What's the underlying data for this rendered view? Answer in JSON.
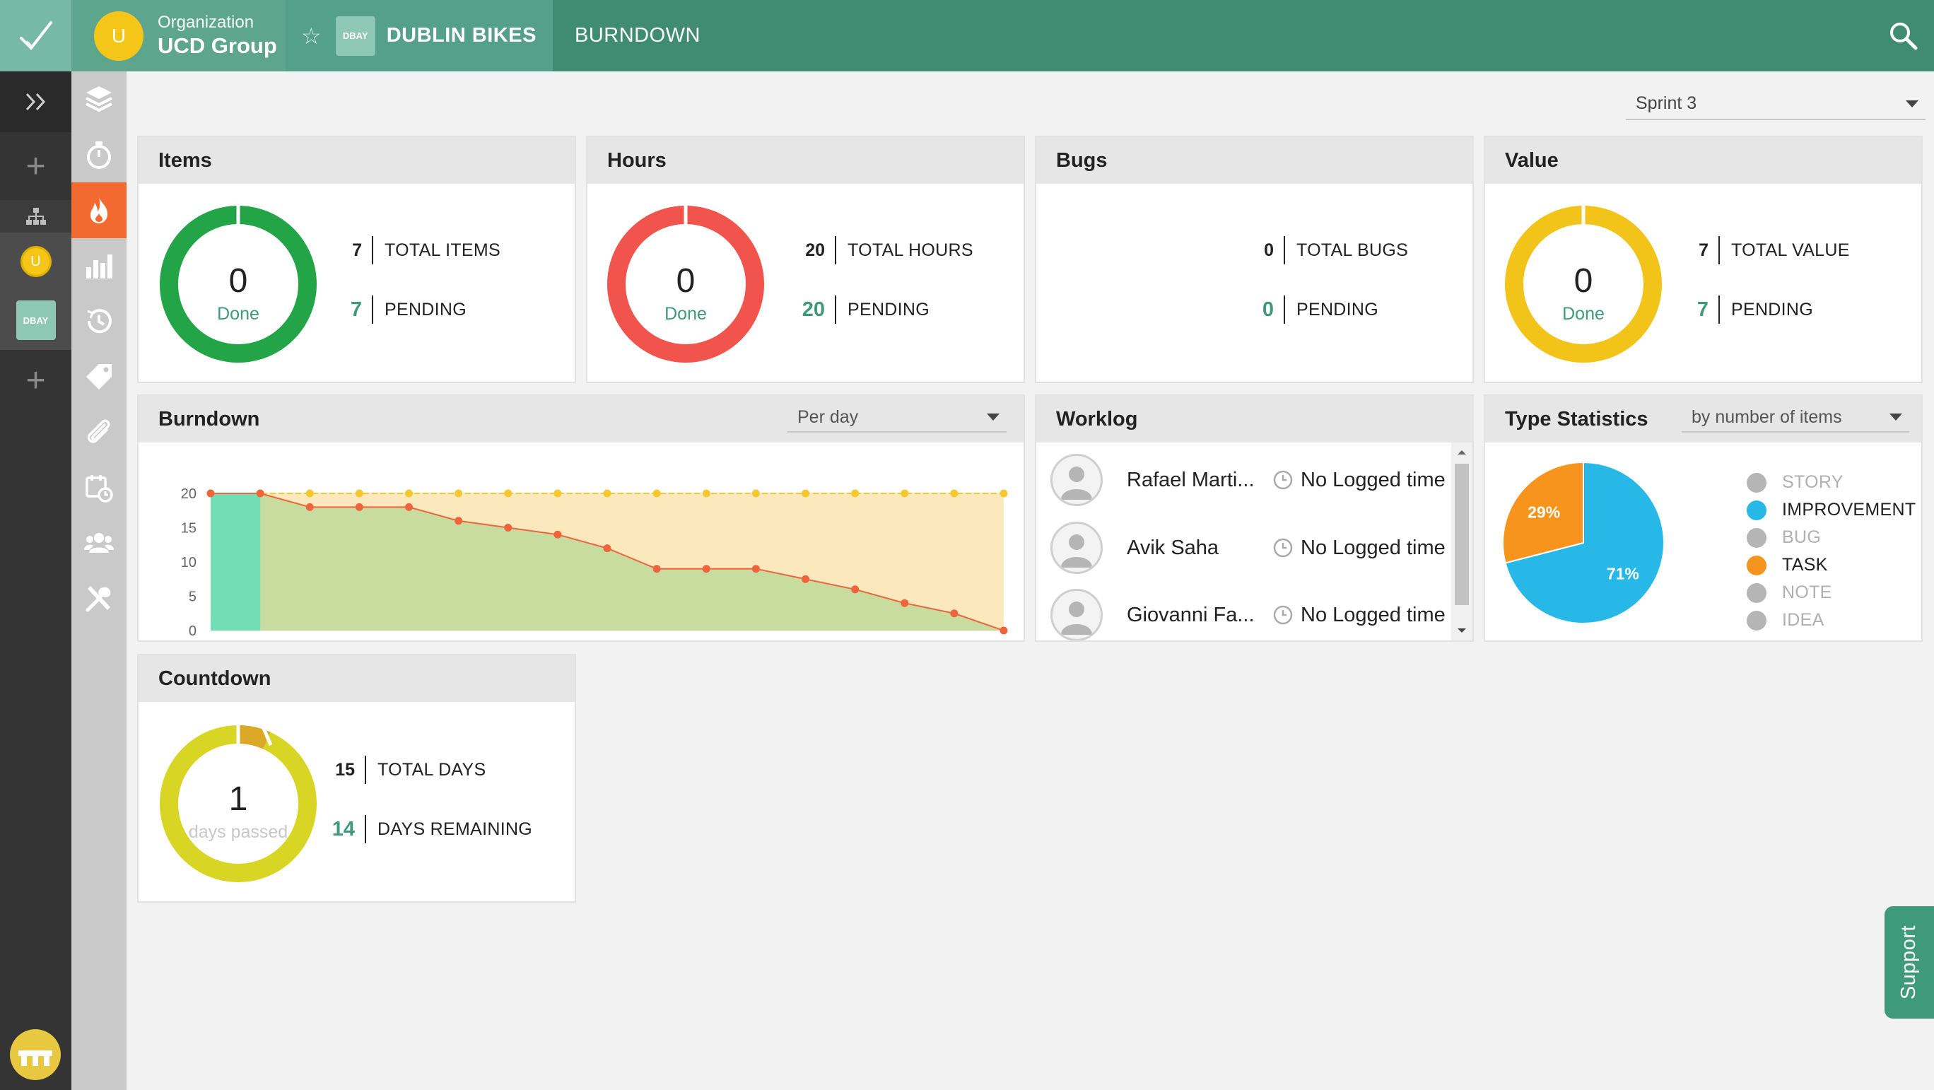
{
  "header": {
    "org_label": "Organization",
    "org_name": "UCD Group",
    "org_avatar_letter": "U",
    "project_badge": "DBAY",
    "project_name": "DUBLIN BIKES",
    "page_title": "BURNDOWN"
  },
  "sidebar": {
    "avatar_letter": "U",
    "project_badge": "DBAY"
  },
  "sprint_select": {
    "value": "Sprint 3"
  },
  "items_card": {
    "title": "Items",
    "center_value": "0",
    "center_label": "Done",
    "total_value": "7",
    "total_label": "TOTAL ITEMS",
    "pending_value": "7",
    "pending_label": "PENDING",
    "color": "#22a447"
  },
  "hours_card": {
    "title": "Hours",
    "center_value": "0",
    "center_label": "Done",
    "total_value": "20",
    "total_label": "TOTAL HOURS",
    "pending_value": "20",
    "pending_label": "PENDING",
    "color": "#f0544c"
  },
  "bugs_card": {
    "title": "Bugs",
    "total_value": "0",
    "total_label": "TOTAL BUGS",
    "pending_value": "0",
    "pending_label": "PENDING"
  },
  "value_card": {
    "title": "Value",
    "center_value": "0",
    "center_label": "Done",
    "total_value": "7",
    "total_label": "TOTAL VALUE",
    "pending_value": "7",
    "pending_label": "PENDING",
    "color": "#f2c318"
  },
  "burndown_card": {
    "title": "Burndown",
    "period_select": "Per day"
  },
  "worklog_card": {
    "title": "Worklog",
    "entries": [
      {
        "name": "Rafael Marti...",
        "time": "No Logged time"
      },
      {
        "name": "Avik Saha",
        "time": "No Logged time"
      },
      {
        "name": "Giovanni Fa...",
        "time": "No Logged time"
      }
    ]
  },
  "type_stats_card": {
    "title": "Type Statistics",
    "mode_select": "by number of items",
    "legend": [
      {
        "label": "STORY",
        "color": "#b5b5b5",
        "active": false
      },
      {
        "label": "IMPROVEMENT",
        "color": "#27b8e8",
        "active": true
      },
      {
        "label": "BUG",
        "color": "#b5b5b5",
        "active": false
      },
      {
        "label": "TASK",
        "color": "#f7941d",
        "active": true
      },
      {
        "label": "NOTE",
        "color": "#b5b5b5",
        "active": false
      },
      {
        "label": "IDEA",
        "color": "#b5b5b5",
        "active": false
      }
    ]
  },
  "countdown_card": {
    "title": "Countdown",
    "center_value": "1",
    "center_label": "days passed",
    "total_value": "15",
    "total_label": "TOTAL DAYS",
    "remaining_value": "14",
    "remaining_label": "DAYS REMAINING"
  },
  "support_label": "Support",
  "chart_data": [
    {
      "type": "area",
      "title": "Burndown",
      "x": [
        1,
        2,
        3,
        4,
        5,
        6,
        7,
        8,
        9,
        10,
        11,
        12,
        13,
        14,
        15,
        16,
        17
      ],
      "ylim": [
        0,
        20
      ],
      "yticks": [
        0,
        5,
        10,
        15,
        20
      ],
      "grid": true,
      "series": [
        {
          "values": [
            20,
            20,
            20,
            20,
            20,
            20,
            20,
            20,
            20,
            20,
            20,
            20,
            20,
            20,
            20,
            20,
            20
          ],
          "color": "#f5c830"
        },
        {
          "values": [
            20,
            20,
            18,
            18,
            18,
            16,
            15,
            14,
            12,
            9,
            9,
            9,
            7.5,
            6,
            4,
            2.5,
            0
          ],
          "color": "#f0643c"
        }
      ],
      "highlight_day": 1
    },
    {
      "type": "pie",
      "title": "Type Statistics",
      "slices": [
        {
          "label": "IMPROVEMENT",
          "value": 71,
          "color": "#27b8e8"
        },
        {
          "label": "TASK",
          "value": 29,
          "color": "#f7941d"
        }
      ]
    }
  ]
}
